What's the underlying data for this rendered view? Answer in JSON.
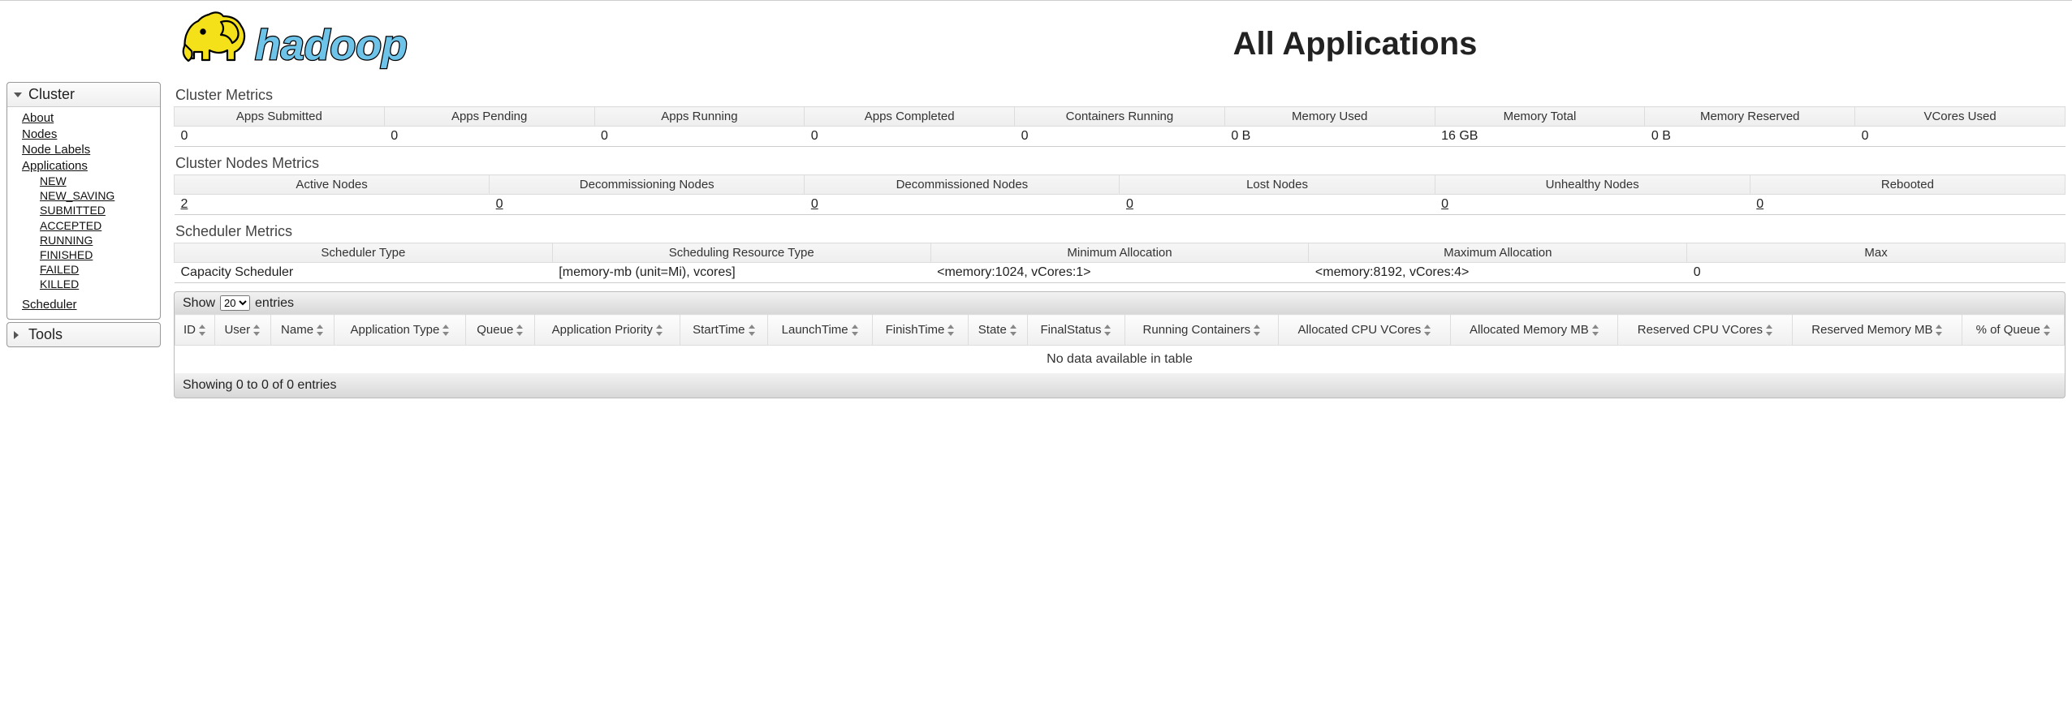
{
  "page_title": "All Applications",
  "logo_text": "hadoop",
  "sidebar": {
    "cluster": {
      "label": "Cluster",
      "links": {
        "about": "About",
        "nodes": "Nodes",
        "node_labels": "Node Labels",
        "applications": "Applications",
        "scheduler": "Scheduler"
      },
      "app_states": {
        "new": "NEW",
        "new_saving": "NEW_SAVING",
        "submitted": "SUBMITTED",
        "accepted": "ACCEPTED",
        "running": "RUNNING",
        "finished": "FINISHED",
        "failed": "FAILED",
        "killed": "KILLED"
      }
    },
    "tools": {
      "label": "Tools"
    }
  },
  "sections": {
    "cluster_metrics": "Cluster Metrics",
    "cluster_nodes_metrics": "Cluster Nodes Metrics",
    "scheduler_metrics": "Scheduler Metrics"
  },
  "cluster_metrics": {
    "headers": {
      "apps_submitted": "Apps Submitted",
      "apps_pending": "Apps Pending",
      "apps_running": "Apps Running",
      "apps_completed": "Apps Completed",
      "containers_running": "Containers Running",
      "memory_used": "Memory Used",
      "memory_total": "Memory Total",
      "memory_reserved": "Memory Reserved",
      "vcores_used": "VCores Used"
    },
    "values": {
      "apps_submitted": "0",
      "apps_pending": "0",
      "apps_running": "0",
      "apps_completed": "0",
      "containers_running": "0",
      "memory_used": "0 B",
      "memory_total": "16 GB",
      "memory_reserved": "0 B",
      "vcores_used": "0"
    }
  },
  "nodes_metrics": {
    "headers": {
      "active": "Active Nodes",
      "decommissioning": "Decommissioning Nodes",
      "decommissioned": "Decommissioned Nodes",
      "lost": "Lost Nodes",
      "unhealthy": "Unhealthy Nodes",
      "rebooted": "Rebooted"
    },
    "values": {
      "active": "2",
      "decommissioning": "0",
      "decommissioned": "0",
      "lost": "0",
      "unhealthy": "0",
      "rebooted": "0"
    }
  },
  "scheduler_metrics": {
    "headers": {
      "type": "Scheduler Type",
      "resource_type": "Scheduling Resource Type",
      "min_alloc": "Minimum Allocation",
      "max_alloc": "Maximum Allocation",
      "max": "Max"
    },
    "values": {
      "type": "Capacity Scheduler",
      "resource_type": "[memory-mb (unit=Mi), vcores]",
      "min_alloc": "<memory:1024, vCores:1>",
      "max_alloc": "<memory:8192, vCores:4>",
      "max": "0"
    }
  },
  "apps_table": {
    "show_label_pre": "Show",
    "show_label_post": "entries",
    "page_size": "20",
    "headers": {
      "id": "ID",
      "user": "User",
      "name": "Name",
      "app_type": "Application Type",
      "queue": "Queue",
      "priority": "Application Priority",
      "start": "StartTime",
      "launch": "LaunchTime",
      "finish": "FinishTime",
      "state": "State",
      "final": "FinalStatus",
      "running_containers": "Running Containers",
      "alloc_cpu": "Allocated CPU VCores",
      "alloc_mem": "Allocated Memory MB",
      "res_cpu": "Reserved CPU VCores",
      "res_mem": "Reserved Memory MB",
      "pct_queue": "% of Queue"
    },
    "empty": "No data available in table",
    "footer": "Showing 0 to 0 of 0 entries"
  }
}
